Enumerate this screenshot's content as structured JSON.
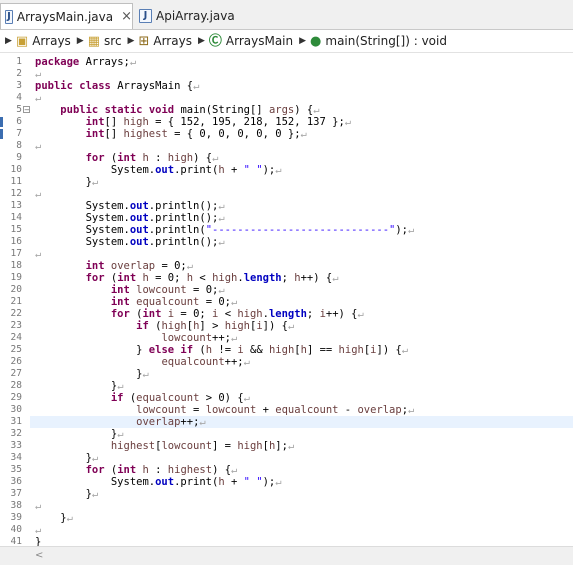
{
  "tabs": [
    {
      "label": "ArraysMain.java",
      "close": "×",
      "active": true
    },
    {
      "label": "ApiArray.java",
      "active": false
    }
  ],
  "breadcrumb": [
    "Arrays",
    "src",
    "Arrays",
    "ArraysMain",
    "main(String[]) : void"
  ],
  "editor": {
    "current_line": 31,
    "code_lines": [
      {
        "n": "1",
        "text": "package Arrays;↵"
      },
      {
        "n": "2",
        "text": "↵"
      },
      {
        "n": "3",
        "text": "public class ArraysMain {↵"
      },
      {
        "n": "4",
        "text": "↵"
      },
      {
        "n": "5",
        "text": "    public static void main(String[] args) {↵"
      },
      {
        "n": "6",
        "text": "        int[] high = { 152, 195, 218, 152, 137 };↵"
      },
      {
        "n": "7",
        "text": "        int[] highest = { 0, 0, 0, 0, 0 };↵"
      },
      {
        "n": "8",
        "text": "↵"
      },
      {
        "n": "9",
        "text": "        for (int h : high) {↵"
      },
      {
        "n": "10",
        "text": "            System.out.print(h + \" \");↵"
      },
      {
        "n": "11",
        "text": "        }↵"
      },
      {
        "n": "12",
        "text": "↵"
      },
      {
        "n": "13",
        "text": "        System.out.println();↵"
      },
      {
        "n": "14",
        "text": "        System.out.println();↵"
      },
      {
        "n": "15",
        "text": "        System.out.println(\"----------------------------\");↵"
      },
      {
        "n": "16",
        "text": "        System.out.println();↵"
      },
      {
        "n": "17",
        "text": "↵"
      },
      {
        "n": "18",
        "text": "        int overlap = 0;↵"
      },
      {
        "n": "19",
        "text": "        for (int h = 0; h < high.length; h++) {↵"
      },
      {
        "n": "20",
        "text": "            int lowcount = 0;↵"
      },
      {
        "n": "21",
        "text": "            int equalcount = 0;↵"
      },
      {
        "n": "22",
        "text": "            for (int i = 0; i < high.length; i++) {↵"
      },
      {
        "n": "23",
        "text": "                if (high[h] > high[i]) {↵"
      },
      {
        "n": "24",
        "text": "                    lowcount++;↵"
      },
      {
        "n": "25",
        "text": "                } else if (h != i && high[h] == high[i]) {↵"
      },
      {
        "n": "26",
        "text": "                    equalcount++;↵"
      },
      {
        "n": "27",
        "text": "                }↵"
      },
      {
        "n": "28",
        "text": "            }↵"
      },
      {
        "n": "29",
        "text": "            if (equalcount > 0) {↵"
      },
      {
        "n": "30",
        "text": "                lowcount = lowcount + equalcount - overlap;↵"
      },
      {
        "n": "31",
        "text": "                overlap++;↵"
      },
      {
        "n": "32",
        "text": "            }↵"
      },
      {
        "n": "33",
        "text": "            highest[lowcount] = high[h];↵"
      },
      {
        "n": "34",
        "text": "        }↵"
      },
      {
        "n": "35",
        "text": "        for (int h : highest) {↵"
      },
      {
        "n": "36",
        "text": "            System.out.print(h + \" \");↵"
      },
      {
        "n": "37",
        "text": "        }↵"
      },
      {
        "n": "38",
        "text": "↵"
      },
      {
        "n": "39",
        "text": "    }↵"
      },
      {
        "n": "40",
        "text": "↵"
      },
      {
        "n": "41",
        "text": "}"
      }
    ]
  },
  "colors": {
    "keyword": "#7f0055",
    "field": "#0000c0",
    "local": "#6a3e3e",
    "string": "#2a00ff",
    "crlf": "#a8a8a8",
    "current_line_bg": "#e8f2fe"
  }
}
